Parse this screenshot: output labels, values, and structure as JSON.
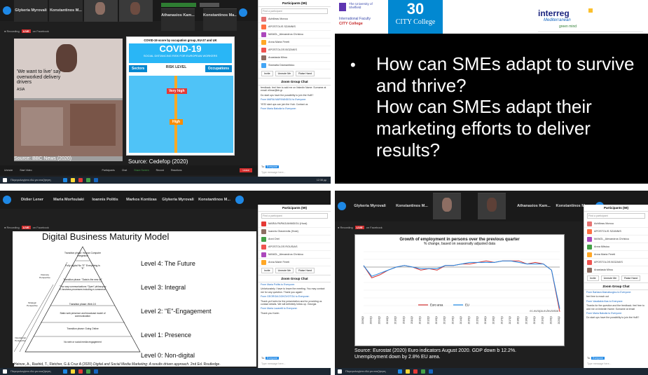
{
  "q1": {
    "participants": [
      "Glykeria Myrovali",
      "Konstantinos M...",
      "Athanasios Kam...",
      "Konstantinos Ma..."
    ],
    "leftTitle": "'We want to live' say overworked delivery drivers",
    "leftTag": "ASIA",
    "leftSource": "Source: BBC News (2020)",
    "covidTitle": "COVID-19 score by occupation group, EU-27 and UK",
    "covidHead": "COVID-19",
    "covidSub": "SOCIAL DISTANCING RISK FOR EUROPEAN WORKERS",
    "sectors": "Sectors",
    "riskLevel": "RISK LEVEL",
    "occupations": "Occupations",
    "veryHigh": "Very high",
    "high": "High",
    "rightSource": "Source: Cedefop (2020)",
    "panelTitle": "Participants (59)",
    "panelSearch": "Find a participant",
    "names": [
      "Achilleas Monou",
      "APOSTOLIS SZANNIS",
      "MANOL_Alexandros Christou",
      "Anna Maria Fereti",
      "APOSTOLOS BOZAKIS",
      "Anastasia Mirou",
      "Stamatia Diamantidou"
    ],
    "panelButtons": [
      "Invite",
      "Unmute Me",
      "Raise Hand"
    ],
    "chatTitle": "Zoom Group Chat",
    "chat": [
      "feedback. feel free to add me on linkedin Name: Surname at email: ellmar@kb.gr",
      "Do start ups have the possibility to join the HuB?",
      "From MARIA MARIVANDOU to Everyone:",
      "YES! start ups can join the Hub. Contact us",
      "From Maria Bakolia to Everyone:"
    ],
    "toLabel": "To:",
    "toValue": "Everyone",
    "typeMsg": "Type message here...",
    "leave": "Leave",
    "controls": [
      "Unmute",
      "Start Video",
      "Participants",
      "Chat",
      "Share Screen",
      "Record",
      "Reactions"
    ],
    "search": "Πληκτρολογήστε εδώ για αναζήτηση",
    "time": "12:38 µµ"
  },
  "q2": {
    "uniName": "The University of Sheffield",
    "cityCollege": "CITY College",
    "intlFaculty": "International Faculty",
    "thirty": "30",
    "interreg": "interreg",
    "mediterranean": "Mediterranean",
    "greenMind": "green mind",
    "bullet": "•",
    "text1": "How can SMEs adapt to survive and thrive?",
    "text2": "How can SMEs adapt their marketing efforts to deliver results?"
  },
  "q3": {
    "participants": [
      "Didier Lener",
      "Maria Morfoulaki",
      "Ioannis Politis",
      "Markos Kontizas",
      "Glykeria Myrovali",
      "Konstantinos M..."
    ],
    "title": "Digital Business Maturity Model",
    "levels": [
      "Level 4: The Future",
      "Level 3: Integral",
      "Level 2: \"E\"-Engagement",
      "Level 1: Presence",
      "Level 0: Non-digital"
    ],
    "pyramid": [
      "Transition phase: Human Computer Integration",
      "Fully digital No \"E\" Everything is \"E\"",
      "Transition phase: \"Data is the new oil\"",
      "\"Two way communications \"Open\" philosophy E-business processes including e-commerce",
      "Transition phase: Web 2.0",
      "Static web presence and broadcast model of communication",
      "Transition phase: Going Online",
      "No web or social media engagement"
    ],
    "sideLabels": [
      "Visionary Perspective",
      "Strategic Perspective",
      "Operational Perspective"
    ],
    "citationPlain": "Heinze, A., Rashid, T., Fletcher, G & Cruz A (2020)",
    "citationItalic": "Digital and Social Media Marketing: A results driven approach.",
    "citationEnd": "2nd Ed. Routledge.",
    "panelTitle": "Participants (59)",
    "panelSearch": "Find a participant",
    "names": [
      "MARIA PAPAGIANNIDOU (Host)",
      "Ioannis Glaveredis (Host)",
      "Anni Orel",
      "APOSTOLOS ROUSIAS",
      "MANOL_Alexandros Christou",
      "Anna Marie Fereti"
    ],
    "panelButtons": [
      "Invite",
      "Unmute Me",
      "Raise Hand"
    ],
    "chatTitle": "Zoom Group Chat",
    "chat": [
      "From Maria Politis to Everyone:",
      "Unfortunately I have to leave the meeting. You may contact me for any question. Thank you again!",
      "From GEORGIA DOKOVOTOU to Everyone:",
      "Thank ya Karim for the presentation and for providing us contact details. We will definitely follow up. Georgia",
      "From Maria Lavarelli to Everyone:",
      "Thank you Karim"
    ],
    "toLabel": "To:",
    "toValue": "Everyone",
    "typeMsg": "Type message here...",
    "search": "Πληκτρολογήστε εδώ για αναζήτηση"
  },
  "q4": {
    "participants": [
      "Glykeria Myrovali",
      "Konstantinos M...",
      "Athanasios Kam...",
      "Konstantinos Ma..."
    ],
    "chartTitle": "Growth of employment in persons over the previous quarter",
    "chartSub": "% change, based on seasonally adjusted data",
    "watermark": "ec.europa.eu/eurostat",
    "source1": "Source: Eurostat (2020) Euro indicators August 2020. GDP down b 12.2%.",
    "source2": "Unemployment down by 2.8% EU area.",
    "panelTitle": "Participants (59)",
    "panelSearch": "Find a participant",
    "names": [
      "Achilleas Monou",
      "APOSTOLIS SZANNIS",
      "MANOL_Alexandros Christou",
      "Anna Mitsiou",
      "Anna Maria Fereti",
      "APOSTOLOS BOZAKIS",
      "Anastasia Mirou"
    ],
    "panelButtons": [
      "Invite",
      "Unmute Me",
      "Raise Hand"
    ],
    "chatTitle": "Zoom Group Chat",
    "chat": [
      "From Barbara Mamatsoglou to Everyone:",
      "feel free to reach out",
      "From Vassilakis Ilias to Everyone:",
      "Thanks for the question and the feedback. feel free to add me on linkedin Name: Surname at email",
      "From Maria Bakolia to Everyone:",
      "Do start ups have the possibility to join the HuB?"
    ],
    "toLabel": "To:",
    "toValue": "Everyone",
    "typeMsg": "Type message here...",
    "search": "Πληκτρολογήστε εδώ για αναζήτηση"
  },
  "chart_data": {
    "type": "line",
    "title": "Growth of employment in persons over the previous quarter",
    "subtitle": "% change, based on seasonally adjusted data",
    "categories": [
      "2008Q3",
      "2009Q1",
      "2009Q3",
      "2010Q1",
      "2010Q3",
      "2011Q1",
      "2011Q3",
      "2012Q1",
      "2012Q3",
      "2013Q1",
      "2013Q3",
      "2014Q1",
      "2014Q3",
      "2015Q1",
      "2015Q3",
      "2016Q1",
      "2016Q3",
      "2017Q1",
      "2017Q3",
      "2018Q1",
      "2018Q3",
      "2019Q1",
      "2019Q3",
      "2020Q1",
      "2020Q2"
    ],
    "series": [
      {
        "name": "Euro area",
        "color": "#d32f2f",
        "values": [
          0.1,
          -0.7,
          -0.5,
          -0.2,
          0.0,
          0.1,
          0.0,
          -0.2,
          -0.1,
          -0.2,
          0.1,
          0.1,
          0.2,
          0.2,
          0.3,
          0.4,
          0.3,
          0.4,
          0.4,
          0.4,
          0.2,
          0.3,
          0.2,
          -0.2,
          -2.9
        ]
      },
      {
        "name": "EU",
        "color": "#1e88e5",
        "values": [
          0.1,
          -0.6,
          -0.4,
          -0.2,
          0.0,
          0.1,
          0.0,
          -0.1,
          -0.1,
          -0.1,
          0.1,
          0.1,
          0.2,
          0.3,
          0.3,
          0.3,
          0.3,
          0.4,
          0.4,
          0.3,
          0.2,
          0.2,
          0.2,
          -0.2,
          -2.7
        ]
      }
    ],
    "ylim": [
      -3,
      1
    ]
  }
}
